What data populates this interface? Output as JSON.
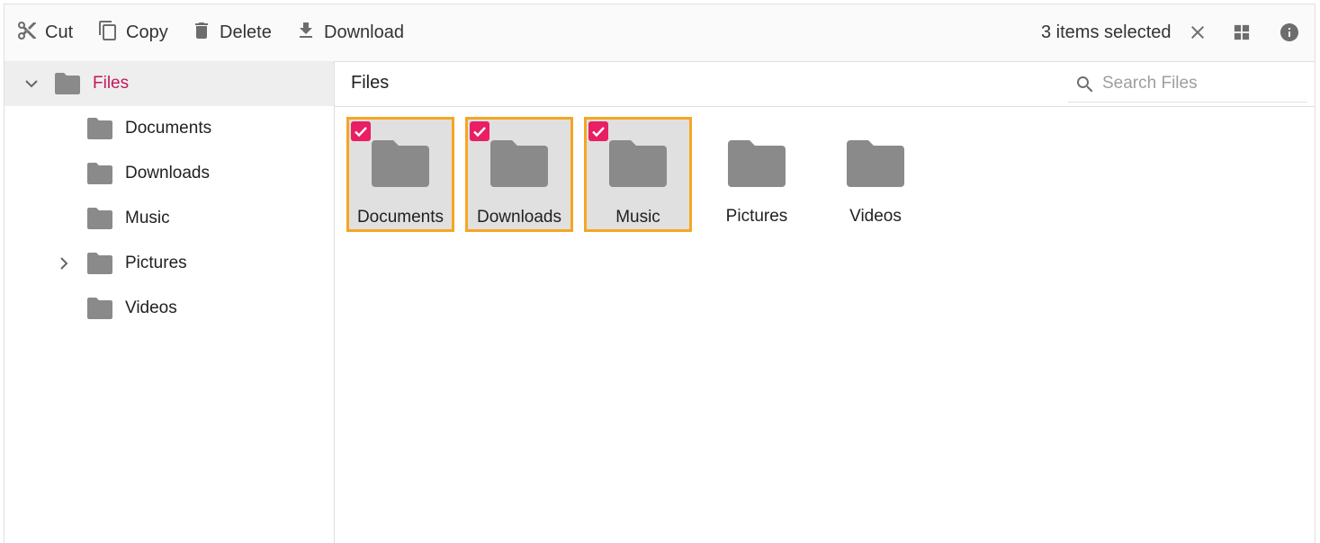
{
  "toolbar": {
    "cut_label": "Cut",
    "copy_label": "Copy",
    "delete_label": "Delete",
    "download_label": "Download",
    "selection_status": "3 items selected"
  },
  "navigation": {
    "root": {
      "label": "Files",
      "expanded": true,
      "selected": true
    },
    "items": [
      {
        "label": "Documents",
        "has_children": false
      },
      {
        "label": "Downloads",
        "has_children": false
      },
      {
        "label": "Music",
        "has_children": false
      },
      {
        "label": "Pictures",
        "has_children": true
      },
      {
        "label": "Videos",
        "has_children": false
      }
    ]
  },
  "content": {
    "breadcrumb": "Files",
    "search_placeholder": "Search Files",
    "tiles": [
      {
        "label": "Documents",
        "selected": true
      },
      {
        "label": "Downloads",
        "selected": true
      },
      {
        "label": "Music",
        "selected": true
      },
      {
        "label": "Pictures",
        "selected": false
      },
      {
        "label": "Videos",
        "selected": false
      }
    ]
  },
  "colors": {
    "accent": "#c2185b",
    "checkbox": "#e91e63",
    "selection_border": "#f5a623",
    "folder": "#8a8a8a"
  }
}
